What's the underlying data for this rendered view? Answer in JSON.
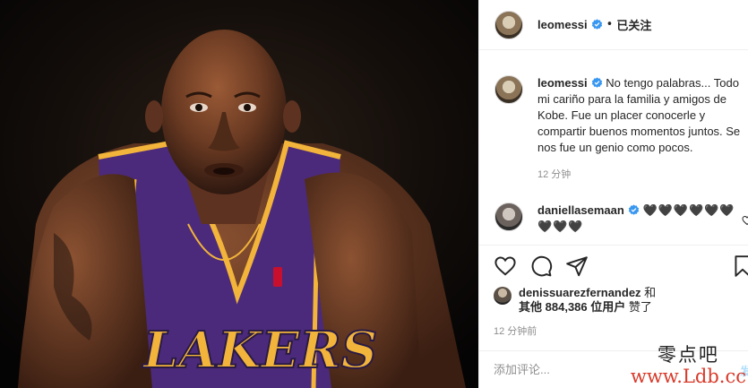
{
  "header": {
    "username": "leomessi",
    "separator": "•",
    "follow_state": "已关注"
  },
  "caption": {
    "username": "leomessi",
    "text": "No tengo palabras... Todo mi cariño para la familia y amigos de Kobe. Fue un placer conocerle y compartir buenos momentos juntos. Se nos fue un genio como pocos.",
    "time": "12 分钟"
  },
  "comment": {
    "username": "daniellasemaan",
    "text": "🖤🖤🖤🖤🖤🖤🖤🖤🖤"
  },
  "likes": {
    "user": "denissuarezfernandez",
    "joiner": "和",
    "others_prefix": "其他",
    "count": "884,386",
    "others_suffix": "位用户",
    "action": "赞了"
  },
  "post_time": "12 分钟前",
  "add_comment": {
    "placeholder": "添加评论...",
    "post_label": "发布"
  },
  "watermark": {
    "line1": "零点吧",
    "line2": "www.Ldb.cc"
  },
  "colors": {
    "verified": "#3897f0",
    "secondary_text": "#8e8e8e",
    "border": "#efefef",
    "jersey_purple": "#4b2a7b",
    "jersey_gold": "#f2b43a"
  },
  "icons": [
    "verified-badge-icon",
    "heart-icon",
    "comment-icon",
    "share-icon",
    "bookmark-icon"
  ]
}
